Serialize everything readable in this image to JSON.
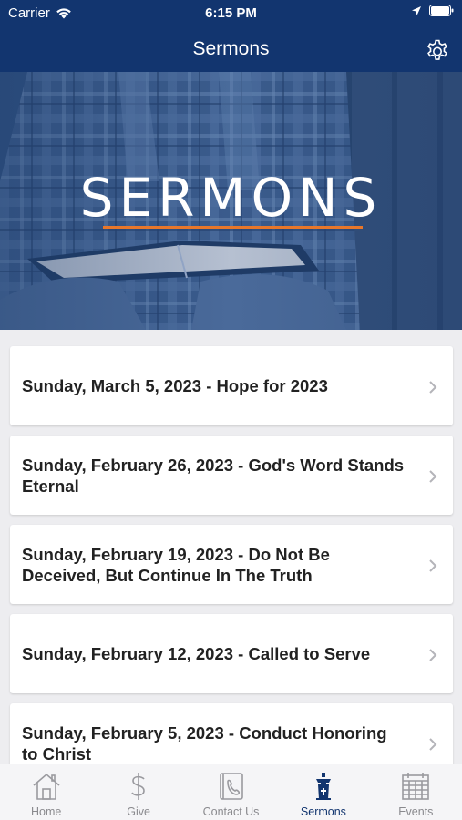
{
  "status_bar": {
    "carrier": "Carrier",
    "time": "6:15 PM"
  },
  "nav": {
    "title": "Sermons"
  },
  "hero": {
    "title": "SERMONS"
  },
  "sermons": [
    {
      "label": "Sunday, March 5, 2023 - Hope for 2023"
    },
    {
      "label": "Sunday, February 26, 2023 - God's Word Stands Eternal"
    },
    {
      "label": "Sunday, February 19, 2023 - Do Not Be Deceived, But Continue In The Truth"
    },
    {
      "label": "Sunday, February 12, 2023 - Called to Serve"
    },
    {
      "label": "Sunday, February 5, 2023 - Conduct Honoring to Christ"
    }
  ],
  "tabs": [
    {
      "label": "Home",
      "icon": "house-icon"
    },
    {
      "label": "Give",
      "icon": "dollar-icon"
    },
    {
      "label": "Contact Us",
      "icon": "phone-book-icon"
    },
    {
      "label": "Sermons",
      "icon": "pulpit-icon",
      "active": true
    },
    {
      "label": "Events",
      "icon": "calendar-icon"
    }
  ],
  "colors": {
    "brand": "#12356f",
    "accent": "#e8772a",
    "inactive": "#8a8a8e"
  }
}
